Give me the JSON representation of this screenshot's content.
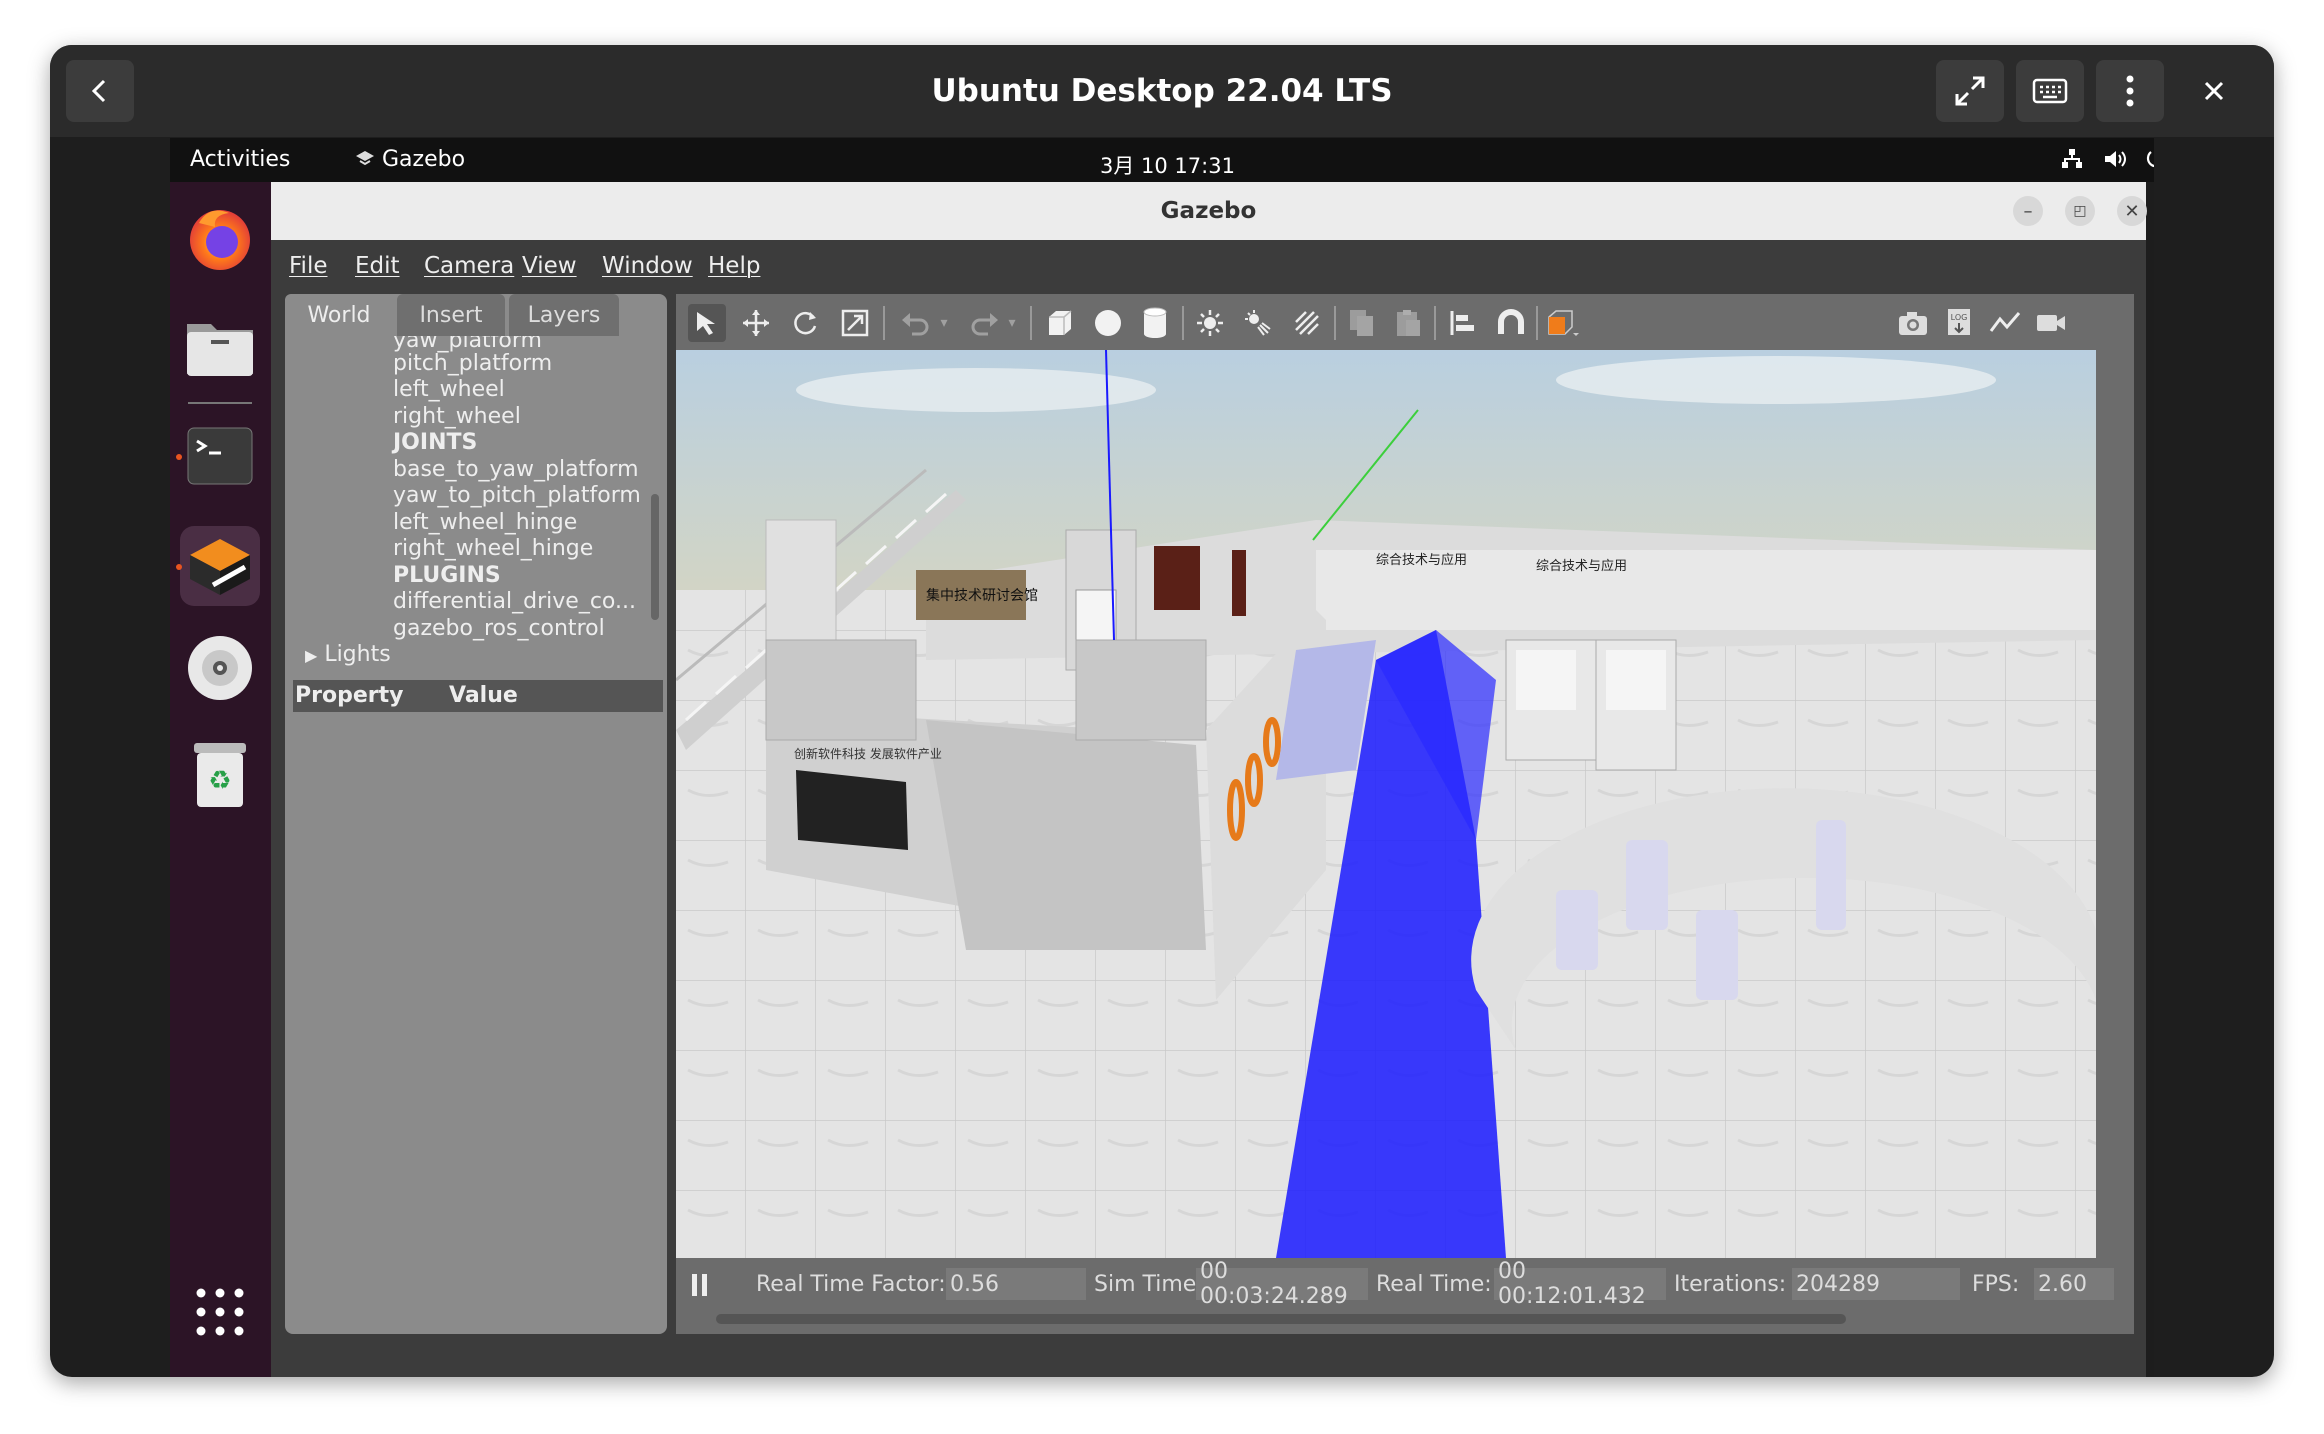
{
  "vm_window": {
    "title": "Ubuntu Desktop 22.04 LTS"
  },
  "topbar": {
    "activities": "Activities",
    "app_name": "Gazebo",
    "datetime": "3月 10  17:31"
  },
  "gazebo": {
    "title": "Gazebo",
    "menu": [
      "File",
      "Edit",
      "Camera",
      "View",
      "Window",
      "Help"
    ],
    "tabs": [
      "World",
      "Insert",
      "Layers"
    ],
    "tree_items": [
      {
        "label": "yaw_platform",
        "bold": false
      },
      {
        "label": "pitch_platform",
        "bold": false
      },
      {
        "label": "left_wheel",
        "bold": false
      },
      {
        "label": "right_wheel",
        "bold": false
      },
      {
        "label": "JOINTS",
        "bold": true
      },
      {
        "label": "base_to_yaw_platform",
        "bold": false
      },
      {
        "label": "yaw_to_pitch_platform",
        "bold": false
      },
      {
        "label": "left_wheel_hinge",
        "bold": false
      },
      {
        "label": "right_wheel_hinge",
        "bold": false
      },
      {
        "label": "PLUGINS",
        "bold": true
      },
      {
        "label": "differential_drive_co...",
        "bold": false
      },
      {
        "label": "gazebo_ros_control",
        "bold": false
      }
    ],
    "tree_lights": "Lights",
    "property_header": {
      "property": "Property",
      "value": "Value"
    },
    "status": {
      "rtf_label": "Real Time Factor:",
      "rtf_value": "0.56",
      "sim_label": "Sim Time:",
      "sim_value": "00 00:03:24.289",
      "real_label": "Real Time:",
      "real_value": "00 00:12:01.432",
      "iter_label": "Iterations:",
      "iter_value": "204289",
      "fps_label": "FPS:",
      "fps_value": "2.60"
    },
    "scene_signs": {
      "plaque": "集中技术研讨会馆",
      "banner1": "综合技术与应用",
      "banner2": "综合技术与应用",
      "booth": "创新软件科技   发展软件产业"
    }
  },
  "colors": {
    "accent_orange": "#e95420",
    "laser_blue": "#1a1aff",
    "dock_bg": "#2c1426"
  }
}
